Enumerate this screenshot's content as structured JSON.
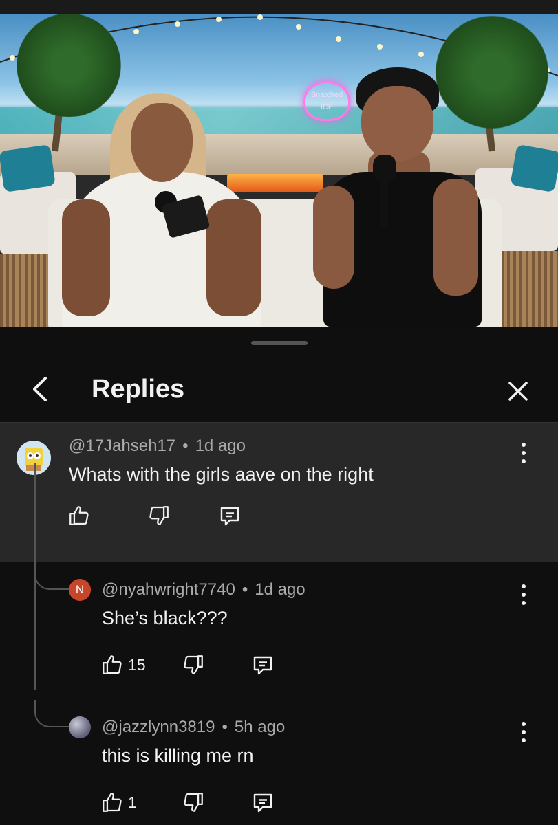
{
  "sheet": {
    "title": "Replies"
  },
  "video": {
    "neon_sign_text": "Snatched ICE"
  },
  "comments": [
    {
      "handle": "@17Jahseh17",
      "time": "1d ago",
      "text": "Whats with the girls aave on the right",
      "likes": "",
      "avatar_letter": ""
    },
    {
      "handle": "@nyahwright7740",
      "time": "1d ago",
      "text": "She’s black???",
      "likes": "15",
      "avatar_letter": "N",
      "avatar_color": "#c7462a"
    },
    {
      "handle": "@jazzlynn3819",
      "time": "5h ago",
      "text": "this is killing me rn",
      "likes": "1",
      "avatar_letter": ""
    }
  ],
  "separator": "•",
  "icons": [
    "back-chevron-icon",
    "close-icon",
    "thumbs-up-icon",
    "thumbs-down-icon",
    "reply-icon",
    "more-vertical-icon"
  ]
}
